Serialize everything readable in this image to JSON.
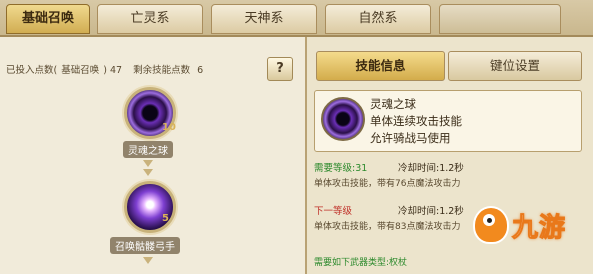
{
  "tabs": [
    "基础召唤",
    "亡灵系",
    "天神系",
    "自然系",
    ""
  ],
  "left": {
    "points_invested_label": "已投入点数(",
    "points_invested_category": "基础召唤",
    "points_invested_value": ") 47",
    "points_remaining_label": "剩余技能点数",
    "points_remaining_value": "6",
    "help": "?"
  },
  "skills": [
    {
      "name": "灵魂之球",
      "level": "10"
    },
    {
      "name": "召唤骷髅弓手",
      "level": "5"
    }
  ],
  "right": {
    "tab_info": "技能信息",
    "tab_keys": "键位设置",
    "skill_name": "灵魂之球",
    "desc_1": "单体连续攻击技能",
    "desc_2": "允许骑战马使用",
    "req_current": "需要等级:31",
    "cd_current": "冷却时间:1.2秒",
    "current_desc": "单体攻击技能，带有76点魔法攻击力",
    "req_next": "下一等级",
    "cd_next": "冷却时间:1.2秒",
    "next_desc": "单体攻击技能，带有83点魔法攻击力",
    "weapon_req": "需要如下武器类型:权杖"
  },
  "watermark": "九游"
}
